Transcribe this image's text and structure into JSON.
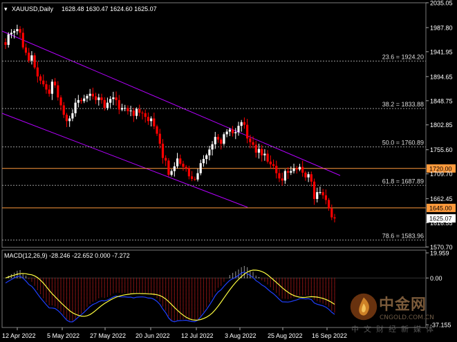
{
  "symbol_title": "XAUUSD,Daily",
  "ohlc_text": "1628.48 1630.47 1624.60 1625.07",
  "macd_title": "MACD(12,26,9) -28.246 -22.652 0.000 -7.272",
  "colors": {
    "bg": "#000000",
    "grid": "#3a3a3a",
    "up": "#ffffff",
    "down": "#ff0000",
    "channel": "#b400ff",
    "level_line": "#ff9a3c",
    "fib_line": "#9a9a9a",
    "macd_pos": "#ffffff",
    "macd_neg": "#e02020",
    "signal": "#ffff40",
    "macd_line": "#2040ff"
  },
  "price_axis": {
    "min": 1570.0,
    "max": 2035.0,
    "ticks": [
      "2035.05",
      "1987.80",
      "1941.95",
      "1894.65",
      "1848.75",
      "1802.85",
      "1755.60",
      "1709.70",
      "1662.45",
      "1616.55",
      "1570.70"
    ]
  },
  "current_price": "1625.07",
  "horizontal_levels": [
    {
      "label": "1720.00",
      "value": 1720.0
    },
    {
      "label": "1645.00",
      "value": 1645.0
    }
  ],
  "fib_levels": [
    {
      "label": "23.6 = 1924.20",
      "value": 1924.2
    },
    {
      "label": "38.2 = 1833.88",
      "value": 1833.88
    },
    {
      "label": "50.0 = 1760.89",
      "value": 1760.89
    },
    {
      "label": "61.8 = 1687.89",
      "value": 1687.89
    },
    {
      "label": "78.6 = 1583.96",
      "value": 1583.96
    }
  ],
  "macd_axis": {
    "ticks": [
      "19.959",
      "0.00",
      "-37.155"
    ],
    "min": -37.155,
    "max": 19.959
  },
  "x_labels": [
    "12 Apr 2022",
    "5 May 2022",
    "27 May 2022",
    "20 Jun 2022",
    "12 Jul 2022",
    "3 Aug 2022",
    "25 Aug 2022",
    "16 Sep 2022"
  ],
  "watermark": {
    "cn": "中金网",
    "en": "CNGOLD.COM.CN",
    "sub": "中文财经新媒体"
  },
  "chart_data": {
    "type": "candlestick",
    "title": "XAUUSD,Daily",
    "start_date": "2022-04-11",
    "closes": [
      1955,
      1975,
      1978,
      1981,
      1985,
      1978,
      1950,
      1940,
      1925,
      1935,
      1912,
      1895,
      1887,
      1880,
      1870,
      1862,
      1885,
      1878,
      1855,
      1840,
      1822,
      1810,
      1815,
      1825,
      1845,
      1850,
      1848,
      1853,
      1858,
      1862,
      1857,
      1850,
      1855,
      1850,
      1835,
      1845,
      1852,
      1855,
      1850,
      1832,
      1835,
      1835,
      1829,
      1830,
      1820,
      1833,
      1826,
      1825,
      1818,
      1810,
      1815,
      1800,
      1786,
      1767,
      1740,
      1735,
      1708,
      1715,
      1724,
      1739,
      1729,
      1723,
      1720,
      1705,
      1700,
      1699,
      1711,
      1730,
      1738,
      1745,
      1756,
      1766,
      1780,
      1775,
      1767,
      1785,
      1790,
      1794,
      1787,
      1789,
      1801,
      1808,
      1803,
      1777,
      1770,
      1765,
      1750,
      1757,
      1745,
      1748,
      1733,
      1728,
      1725,
      1711,
      1701,
      1697,
      1715,
      1712,
      1715,
      1720,
      1718,
      1723,
      1712,
      1703,
      1709,
      1695,
      1662,
      1675,
      1675,
      1669,
      1660,
      1644,
      1627,
      1625
    ],
    "macd": {
      "title": "MACD(12,26,9)",
      "main": -28.246,
      "signal": -22.652,
      "zero": 0.0,
      "osma": -7.272
    }
  }
}
